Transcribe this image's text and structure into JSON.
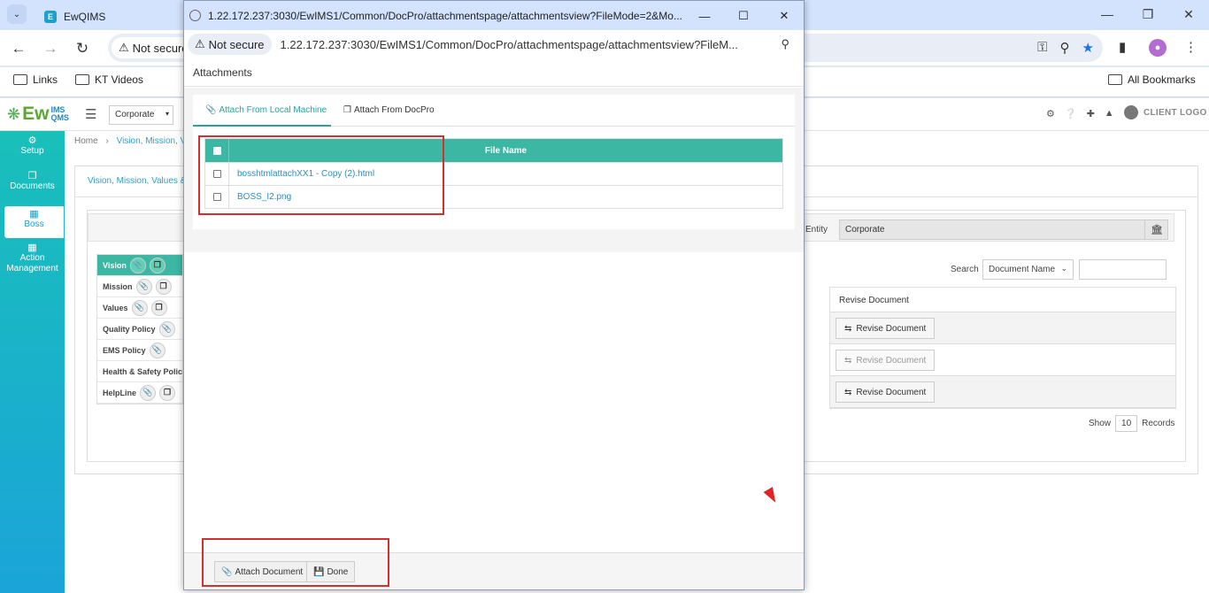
{
  "browser": {
    "tab_title": "EwQIMS",
    "tab_favicon": "ewqims-favicon",
    "address_status": "Not secure",
    "address_url": "",
    "window_controls": [
      "minimize-icon",
      "restore-icon",
      "close-icon"
    ]
  },
  "bookmarks": {
    "items": [
      "Links",
      "KT Videos"
    ],
    "all_bookmarks": "All Bookmarks"
  },
  "header": {
    "logo_text": "Ew",
    "logo_sup_top": "IMS",
    "logo_sup_bottom": "QMS",
    "entity_select": "Corporate",
    "client_logo": "CLIENT LOGO"
  },
  "sidebar": {
    "items": [
      {
        "label": "Setup",
        "icon": "gears-icon"
      },
      {
        "label": "Documents",
        "icon": "copy-icon"
      },
      {
        "label": "Boss",
        "icon": "sitemap-icon",
        "active": true
      },
      {
        "label": "Action Management",
        "icon": "building-icon"
      }
    ]
  },
  "breadcrumb": {
    "home": "Home",
    "current": "Vision, Mission, V"
  },
  "page": {
    "tab_label": "Vision, Mission, Values &",
    "entity_label": "Entity",
    "entity_value": "Corporate",
    "list_items": [
      "Vision",
      "Mission",
      "Values",
      "Quality Policy",
      "EMS Policy",
      "Health & Safety Policy",
      "HelpLine"
    ],
    "search_label": "Search",
    "search_field": "Document Name",
    "revise_header": "Revise Document",
    "revise_buttons": [
      "Revise Document",
      "Revise Document",
      "Revise Document"
    ],
    "show_label": "Show",
    "show_value": "10",
    "records_label": "Records"
  },
  "popup": {
    "title": "1.22.172.237:3030/EwIMS1/Common/DocPro/attachmentspage/attachmentsview?FileMode=2&Mo...",
    "status": "Not secure",
    "url": "1.22.172.237:3030/EwIMS1/Common/DocPro/attachmentspage/attachmentsview?FileM...",
    "header": "Attachments",
    "tabs": [
      "Attach From Local Machine",
      "Attach From DocPro"
    ],
    "table_header": "File Name",
    "files": [
      "bosshtmlattachXX1 - Copy (2).html",
      "BOSS_I2.png"
    ],
    "attach_button": "Attach Document",
    "done_button": "Done"
  },
  "colors": {
    "accent": "#3bb7a4",
    "link": "#2aa2c8",
    "highlight_box": "#d32f2f",
    "sidebar_top": "#19c0ba",
    "sidebar_bottom": "#1aa4d8"
  }
}
